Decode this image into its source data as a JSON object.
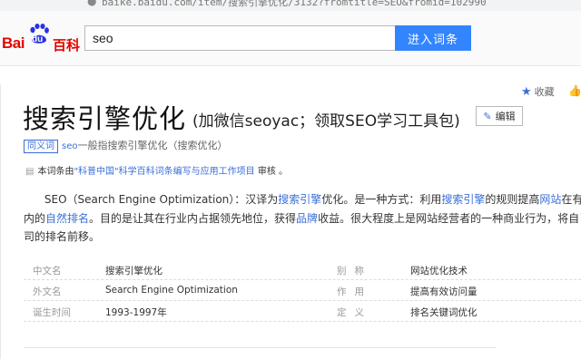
{
  "browser": {
    "url": "baike.baidu.com/item/搜索引擎优化/3132?fromtitle=SEO&fromid=102990"
  },
  "header": {
    "logo": {
      "brand": "Bai",
      "paw_text": "du",
      "product": "百科"
    },
    "search": {
      "value": "seo",
      "button_label": "进入词条"
    }
  },
  "toolbar": {
    "collect_label": "收藏"
  },
  "entry": {
    "title": "搜索引擎优化",
    "subtitle": "(加微信seoyac；领取SEO学习工具包)",
    "edit_label": "编辑",
    "synonym_tag": "同义词",
    "synonym_prefix": "seo",
    "synonym_text": "一般指搜索引擎优化（搜索优化）",
    "review": {
      "prefix": "本词条由",
      "link": "\"科普中国\"科学百科词条编写与应用工作项目",
      "suffix": " 审核 。"
    },
    "paragraph": {
      "l1_a": "SEO（Search Engine Optimization）：汉译为",
      "l1_link1": "搜索引擎",
      "l1_b": "优化。是一种方式：利用",
      "l1_link2": "搜索引擎",
      "l1_c": "的规则提高",
      "l1_link3": "网站",
      "l1_d": "在有关",
      "l2_a": "内的",
      "l2_link1": "自然排名",
      "l2_b": "。目的是让其在行业内占据领先地位，获得",
      "l2_link2": "品牌",
      "l2_c": "收益。很大程度上是网站经营者的一种商业行为，将自己",
      "l3": "司的排名前移。"
    },
    "basic_info": [
      {
        "k": "中文名",
        "v": "搜索引擎优化",
        "k2": "别称",
        "v2": "网站优化技术"
      },
      {
        "k": "外文名",
        "v": "Search Engine Optimization",
        "k2": "作用",
        "v2": "提高有效访问量"
      },
      {
        "k": "诞生时间",
        "v": "1993-1997年",
        "k2": "定义",
        "v2": "排名关键词优化"
      }
    ]
  }
}
